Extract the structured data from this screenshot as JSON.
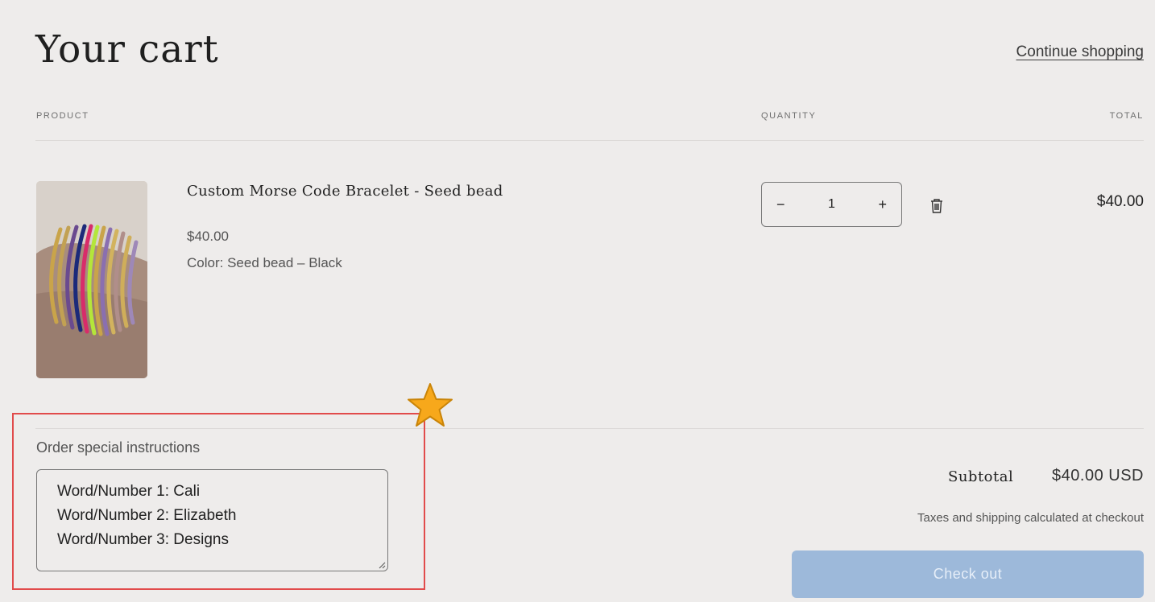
{
  "header": {
    "title": "Your cart",
    "continue_label": "Continue shopping"
  },
  "columns": {
    "product": "PRODUCT",
    "quantity": "QUANTITY",
    "total": "TOTAL"
  },
  "item": {
    "name": "Custom Morse Code Bracelet - Seed bead",
    "price": "$40.00",
    "variant": "Color: Seed bead – Black",
    "quantity": "1",
    "line_total": "$40.00",
    "decrement_symbol": "−",
    "increment_symbol": "+",
    "remove_icon": "trash-icon"
  },
  "instructions": {
    "label": "Order special instructions",
    "lines": [
      "Word/Number 1: Cali",
      "Word/Number 2: Elizabeth",
      "Word/Number 3: Designs"
    ]
  },
  "summary": {
    "subtotal_label": "Subtotal",
    "subtotal_value": "$40.00 USD",
    "tax_note": "Taxes and shipping calculated at checkout",
    "checkout_label": "Check out"
  },
  "colors": {
    "background": "#eeeceb",
    "checkout_button": "#9db9da",
    "highlight_border": "#e14b4b",
    "star": "#f7a81b"
  }
}
